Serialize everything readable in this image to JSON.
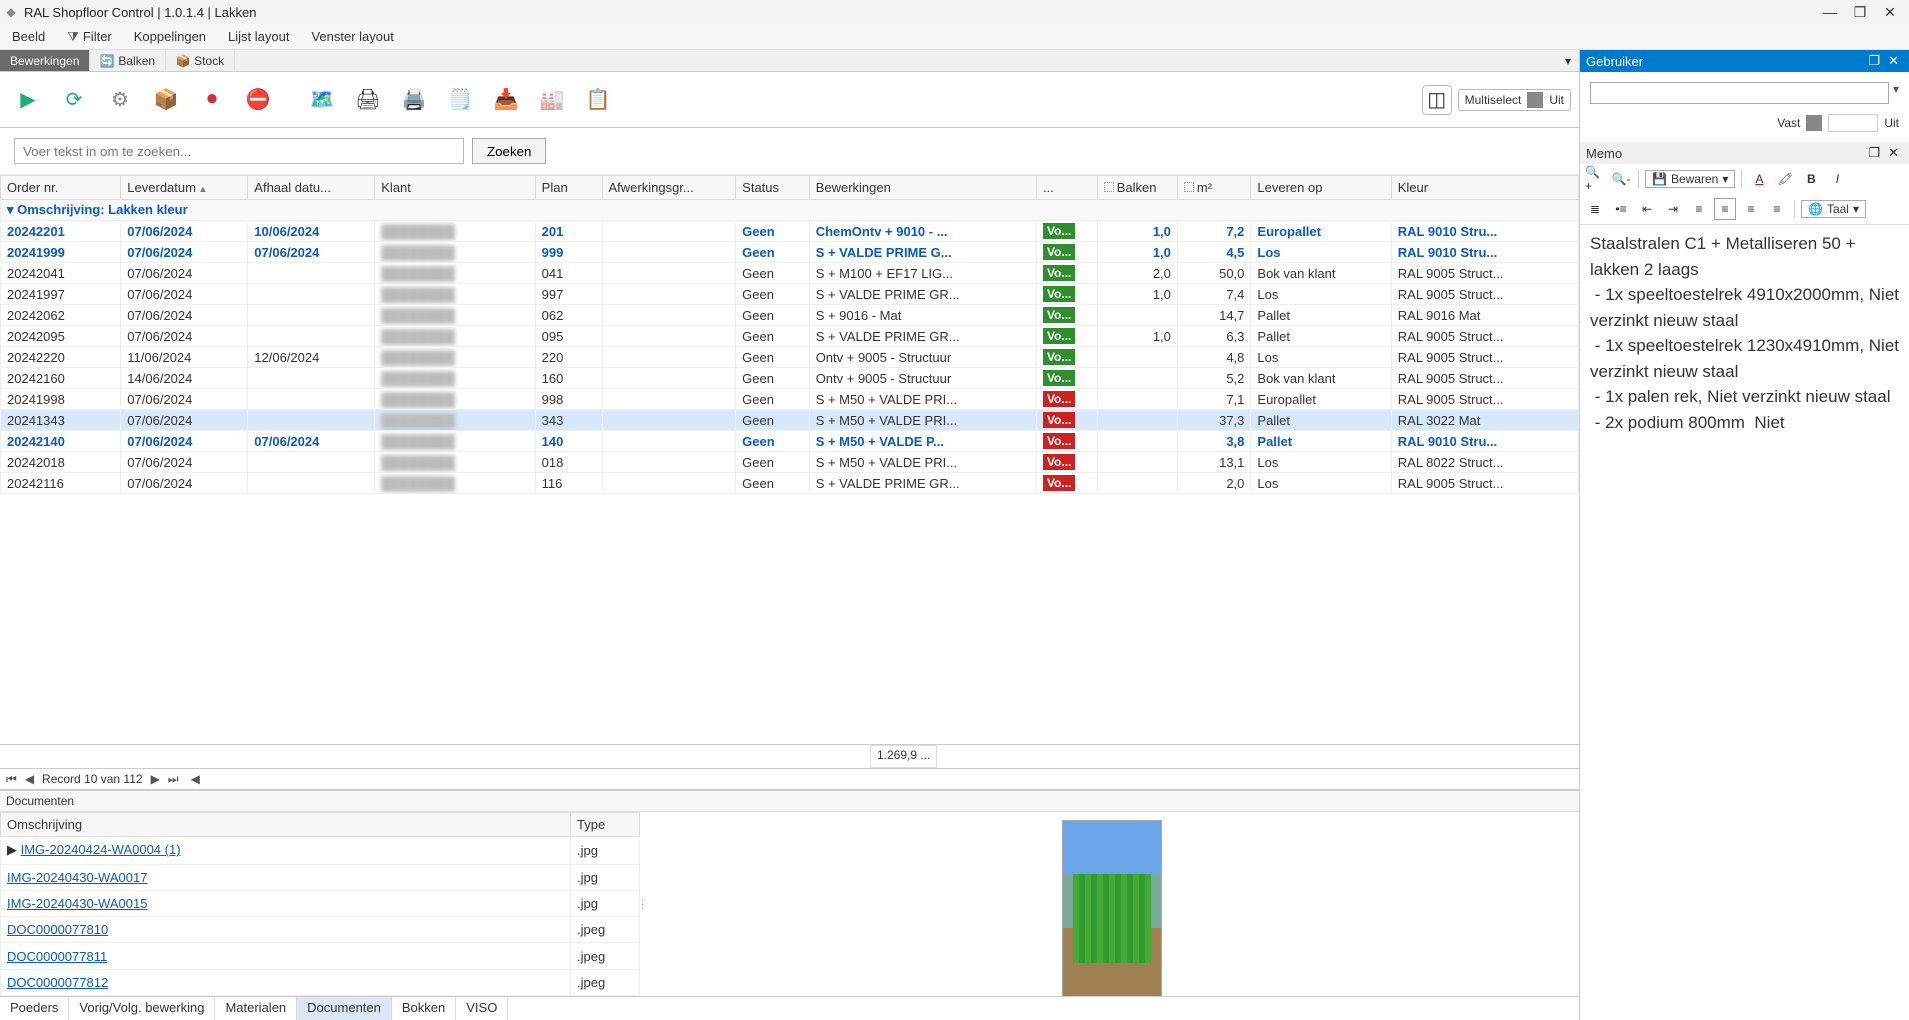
{
  "title": "RAL Shopfloor Control | 1.0.1.4 | Lakken",
  "menu": [
    "Beeld",
    "Filter",
    "Koppelingen",
    "Lijst layout",
    "Venster layout"
  ],
  "top_tabs": [
    {
      "label": "Bewerkingen",
      "icon": ""
    },
    {
      "label": "Balken",
      "icon": "🟢"
    },
    {
      "label": "Stock",
      "icon": "📦"
    }
  ],
  "top_tabs_active": 0,
  "toolbar_icons": [
    "play",
    "refresh",
    "gear",
    "box",
    "record",
    "stop",
    "",
    "scan",
    "barcode",
    "print",
    "note",
    "pack",
    "factory",
    "clipboard"
  ],
  "multiselect": {
    "label": "Multiselect",
    "state": "Uit"
  },
  "search": {
    "placeholder": "Voer tekst in om te zoeken...",
    "button": "Zoeken"
  },
  "grid": {
    "columns": [
      "Order nr.",
      "Leverdatum",
      "Afhaal datu...",
      "Klant",
      "Plan",
      "Afwerkingsgr...",
      "Status",
      "Bewerkingen",
      "...",
      "Balken",
      "m²",
      "Leveren op",
      "Kleur"
    ],
    "sort_col": 1,
    "group_label": "Omschrijving: Lakken kleur",
    "rows": [
      {
        "bold": true,
        "order": "20242201",
        "lever": "07/06/2024",
        "afhaal": "10/06/2024",
        "klant": "",
        "plan": "201",
        "status": "Geen",
        "bewerk": "ChemOntv + 9010 - ...",
        "badge": "Vo...",
        "bcol": "green",
        "balken": "1,0",
        "m2": "7,2",
        "leveren": "Europallet",
        "kleur": "RAL 9010 Stru..."
      },
      {
        "bold": true,
        "order": "20241999",
        "lever": "07/06/2024",
        "afhaal": "07/06/2024",
        "klant": "",
        "plan": "999",
        "status": "Geen",
        "bewerk": "S + VALDE PRIME G...",
        "badge": "Vo...",
        "bcol": "green",
        "balken": "1,0",
        "m2": "4,5",
        "leveren": "Los",
        "kleur": "RAL 9010 Stru..."
      },
      {
        "order": "20242041",
        "lever": "07/06/2024",
        "afhaal": "",
        "klant": "",
        "plan": "041",
        "status": "Geen",
        "bewerk": "S + M100 + EF17 LIG...",
        "badge": "Vo...",
        "bcol": "green",
        "balken": "2,0",
        "m2": "50,0",
        "leveren": "Bok van klant",
        "kleur": "RAL 9005 Struct..."
      },
      {
        "order": "20241997",
        "lever": "07/06/2024",
        "afhaal": "",
        "klant": "",
        "plan": "997",
        "status": "Geen",
        "bewerk": "S + VALDE PRIME GR...",
        "badge": "Vo...",
        "bcol": "green",
        "balken": "1,0",
        "m2": "7,4",
        "leveren": "Los",
        "kleur": "RAL 9005 Struct..."
      },
      {
        "order": "20242062",
        "lever": "07/06/2024",
        "afhaal": "",
        "klant": "",
        "plan": "062",
        "status": "Geen",
        "bewerk": "S + 9016 - Mat",
        "badge": "Vo...",
        "bcol": "green",
        "balken": "",
        "m2": "14,7",
        "leveren": "Pallet",
        "kleur": "RAL 9016 Mat"
      },
      {
        "order": "20242095",
        "lever": "07/06/2024",
        "afhaal": "",
        "klant": "",
        "plan": "095",
        "status": "Geen",
        "bewerk": "S + VALDE PRIME GR...",
        "badge": "Vo...",
        "bcol": "green",
        "balken": "1,0",
        "m2": "6,3",
        "leveren": "Pallet",
        "kleur": "RAL 9005 Struct..."
      },
      {
        "order": "20242220",
        "lever": "11/06/2024",
        "afhaal": "12/06/2024",
        "klant": "",
        "plan": "220",
        "status": "Geen",
        "bewerk": "Ontv + 9005 - Structuur",
        "badge": "Vo...",
        "bcol": "green",
        "balken": "",
        "m2": "4,8",
        "leveren": "Los",
        "kleur": "RAL 9005 Struct..."
      },
      {
        "order": "20242160",
        "lever": "14/06/2024",
        "afhaal": "",
        "klant": "",
        "plan": "160",
        "status": "Geen",
        "bewerk": "Ontv + 9005 - Structuur",
        "badge": "Vo...",
        "bcol": "green",
        "balken": "",
        "m2": "5,2",
        "leveren": "Bok van klant",
        "kleur": "RAL 9005 Struct..."
      },
      {
        "order": "20241998",
        "lever": "07/06/2024",
        "afhaal": "",
        "klant": "",
        "plan": "998",
        "status": "Geen",
        "bewerk": "S + M50 + VALDE PRI...",
        "badge": "Vo...",
        "bcol": "red",
        "balken": "",
        "m2": "7,1",
        "leveren": "Europallet",
        "kleur": "RAL 9005 Struct..."
      },
      {
        "sel": true,
        "order": "20241343",
        "lever": "07/06/2024",
        "afhaal": "",
        "klant": "",
        "plan": "343",
        "status": "Geen",
        "bewerk": "S + M50 + VALDE PRI...",
        "badge": "Vo...",
        "bcol": "red",
        "balken": "",
        "m2": "37,3",
        "leveren": "Pallet",
        "kleur": "RAL 3022 Mat"
      },
      {
        "bold": true,
        "order": "20242140",
        "lever": "07/06/2024",
        "afhaal": "07/06/2024",
        "klant": "",
        "plan": "140",
        "status": "Geen",
        "bewerk": "S + M50 + VALDE P...",
        "badge": "Vo...",
        "bcol": "red",
        "balken": "",
        "m2": "3,8",
        "leveren": "Pallet",
        "kleur": "RAL 9010 Stru..."
      },
      {
        "order": "20242018",
        "lever": "07/06/2024",
        "afhaal": "",
        "klant": "",
        "plan": "018",
        "status": "Geen",
        "bewerk": "S + M50 + VALDE PRI...",
        "badge": "Vo...",
        "bcol": "red",
        "balken": "",
        "m2": "13,1",
        "leveren": "Los",
        "kleur": "RAL 8022 Struct..."
      },
      {
        "order": "20242116",
        "lever": "07/06/2024",
        "afhaal": "",
        "klant": "",
        "plan": "116",
        "status": "Geen",
        "bewerk": "S + VALDE PRIME GR...",
        "badge": "Vo...",
        "bcol": "red",
        "balken": "",
        "m2": "2,0",
        "leveren": "Los",
        "kleur": "RAL 9005 Struct..."
      }
    ],
    "sum_m2": "1.269,9 ..."
  },
  "record_nav": {
    "text": "Record 10 van 112"
  },
  "documents": {
    "title": "Documenten",
    "columns": [
      "Omschrijving",
      "Type"
    ],
    "rows": [
      {
        "name": "IMG-20240424-WA0004 (1)",
        "type": ".jpg",
        "sel": true
      },
      {
        "name": "IMG-20240430-WA0017",
        "type": ".jpg"
      },
      {
        "name": "IMG-20240430-WA0015",
        "type": ".jpg"
      },
      {
        "name": "DOC0000077810",
        "type": ".jpeg"
      },
      {
        "name": "DOC0000077811",
        "type": ".jpeg"
      },
      {
        "name": "DOC0000077812",
        "type": ".jpeg"
      }
    ],
    "tabs": [
      "Poeders",
      "Vorig/Volg. bewerking",
      "Materialen",
      "Documenten",
      "Bokken",
      "VISO"
    ],
    "tabs_active": 3
  },
  "user_panel": {
    "title": "Gebruiker",
    "vast_label": "Vast",
    "vast_state": "Uit"
  },
  "memo_panel": {
    "title": "Memo",
    "save_label": "Bewaren",
    "taal_label": "Taal",
    "body": "Staalstralen C1 + Metalliseren 50 + lakken 2 laags\n - 1x speeltoestelrek 4910x2000mm, Niet verzinkt nieuw staal\n - 1x speeltoestelrek 1230x4910mm, Niet verzinkt nieuw staal\n - 1x palen rek, Niet verzinkt nieuw staal\n - 2x podium 800mm  Niet"
  },
  "colors": {
    "accent": "#007acc",
    "link": "#0a59c9",
    "badge_green": "#2f8f2f",
    "badge_red": "#c22"
  }
}
